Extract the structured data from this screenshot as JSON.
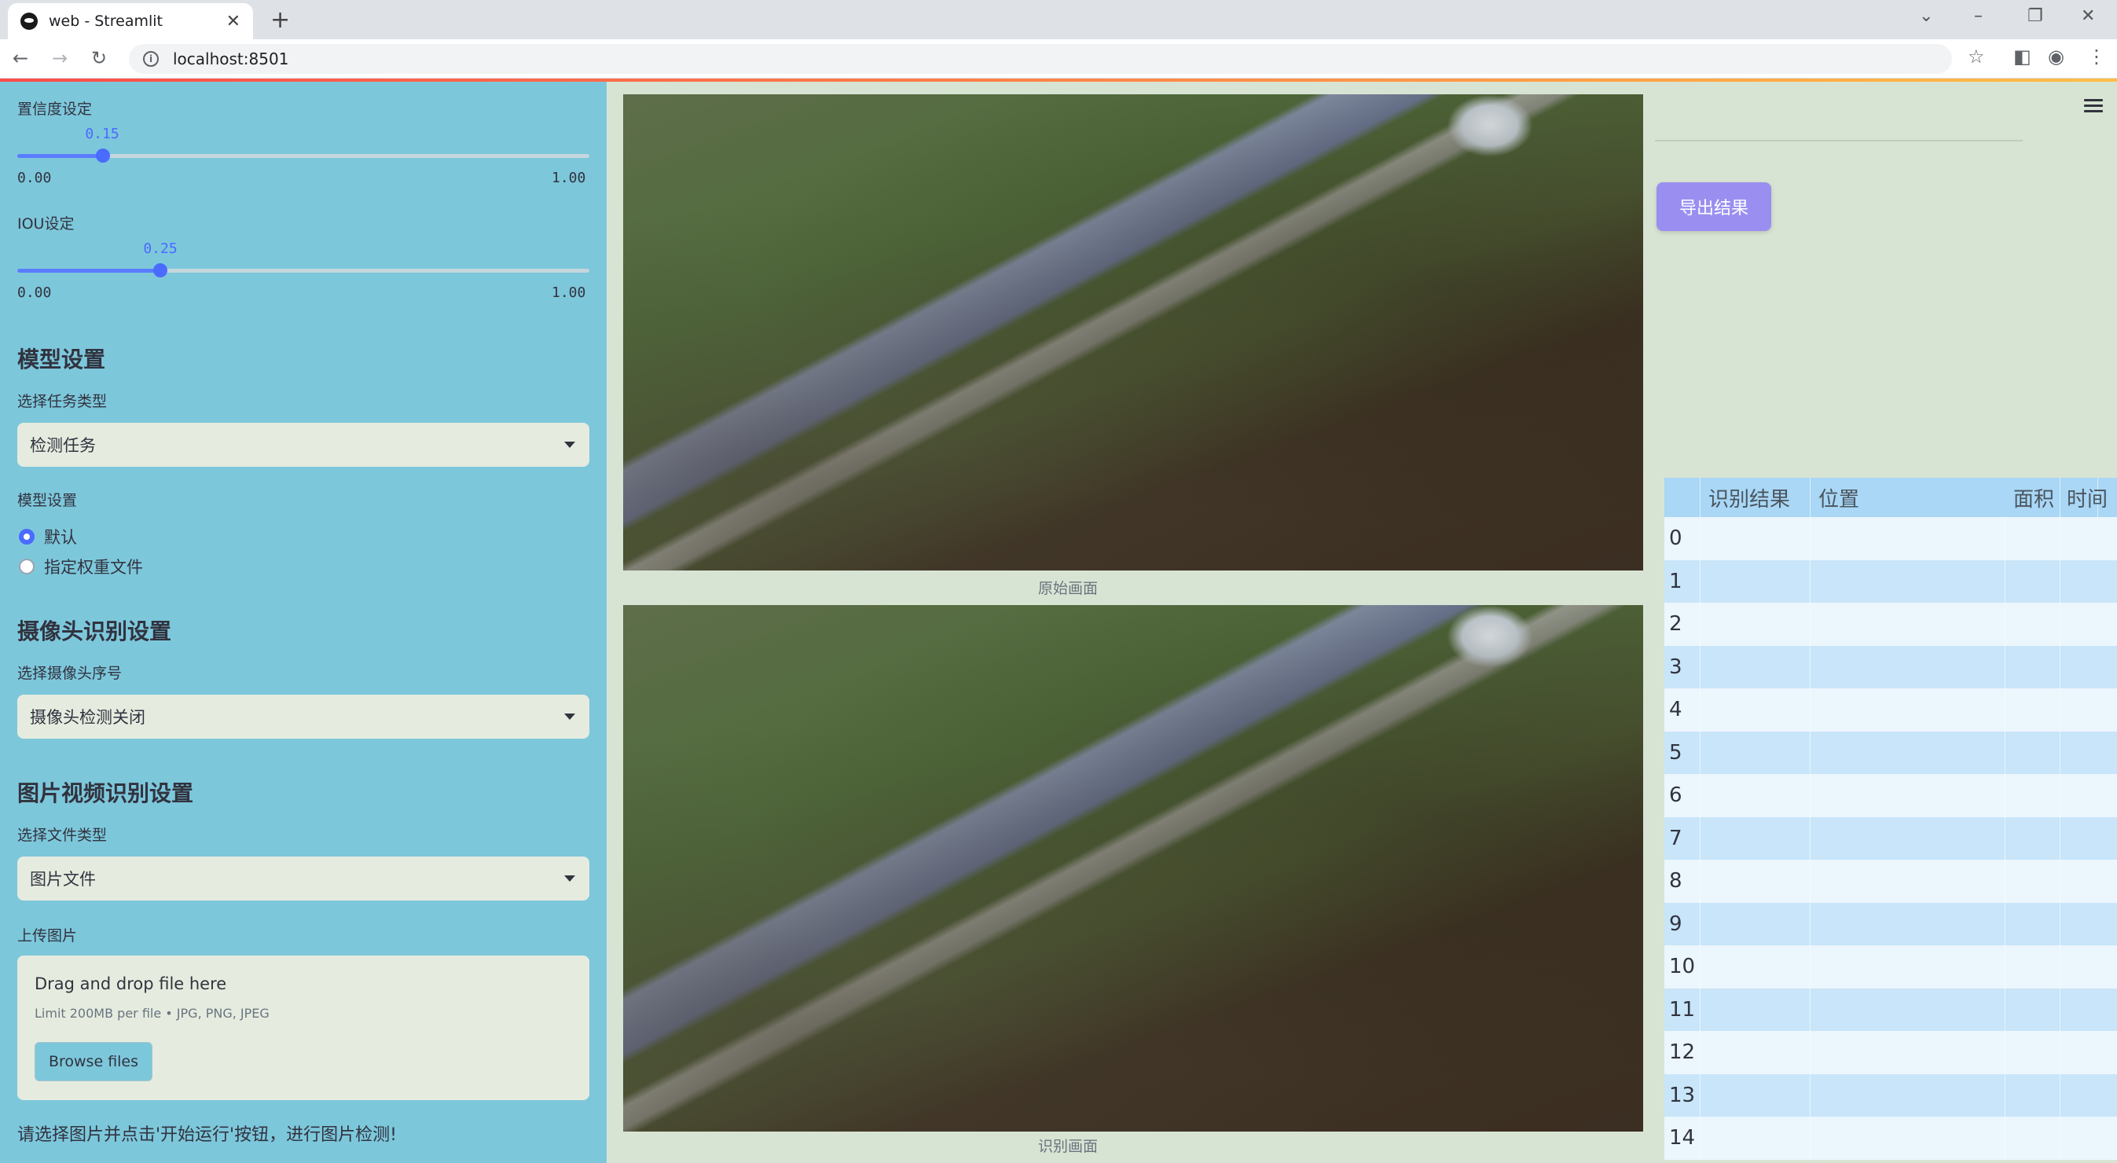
{
  "browser": {
    "tab_title": "web - Streamlit",
    "url": "localhost:8501",
    "new_tab": "+",
    "tab_close": "✕"
  },
  "sidebar": {
    "confidence_label": "置信度设定",
    "confidence_value": "0.15",
    "confidence_fraction": 0.15,
    "confidence_min": "0.00",
    "confidence_max": "1.00",
    "iou_label": "IOU设定",
    "iou_value": "0.25",
    "iou_fraction": 0.25,
    "iou_min": "0.00",
    "iou_max": "1.00",
    "model_heading": "模型设置",
    "task_label": "选择任务类型",
    "task_value": "检测任务",
    "model_setting_label": "模型设置",
    "radio_options": [
      "默认",
      "指定权重文件"
    ],
    "radio_selected": 0,
    "camera_heading": "摄像头识别设置",
    "camera_label": "选择摄像头序号",
    "camera_value": "摄像头检测关闭",
    "media_heading": "图片视频识别设置",
    "filetype_label": "选择文件类型",
    "filetype_value": "图片文件",
    "upload_label": "上传图片",
    "upload_title": "Drag and drop file here",
    "upload_limit": "Limit 200MB per file • JPG, PNG, JPEG",
    "browse_label": "Browse files",
    "footer_text": "请选择图片并点击'开始运行'按钮，进行图片检测!"
  },
  "main": {
    "original_caption": "原始画面",
    "result_caption": "识别画面"
  },
  "right": {
    "export_label": "导出结果",
    "table": {
      "headers": [
        "",
        "识别结果",
        "位置",
        "面积",
        "时间"
      ],
      "row_indices": [
        "0",
        "1",
        "2",
        "3",
        "4",
        "5",
        "6",
        "7",
        "8",
        "9",
        "10",
        "11",
        "12",
        "13",
        "14"
      ]
    }
  },
  "colors": {
    "sidebar_bg": "#7dc7db",
    "accent": "#4a6bff",
    "export_button": "#9a8ff0",
    "table_header": "#a9d7f5"
  }
}
